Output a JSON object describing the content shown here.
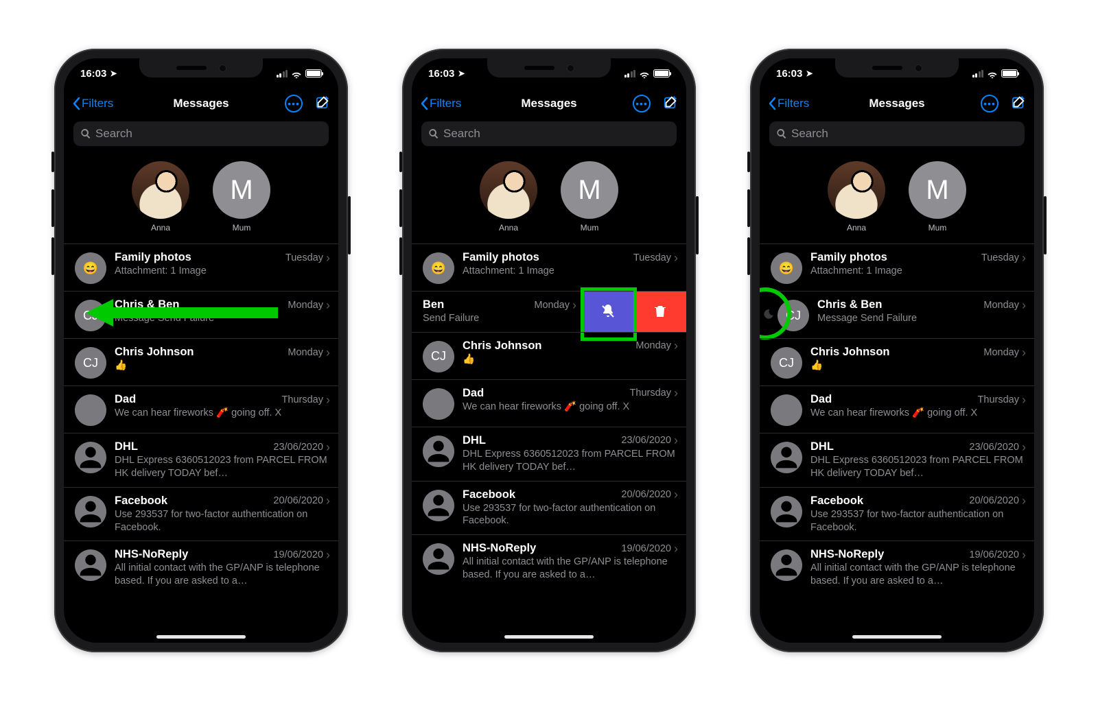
{
  "status": {
    "time": "16:03"
  },
  "nav": {
    "back": "Filters",
    "title": "Messages"
  },
  "search": {
    "placeholder": "Search"
  },
  "pinned": [
    {
      "name": "Anna",
      "avatar": "photo"
    },
    {
      "name": "Mum",
      "avatar": "M"
    }
  ],
  "conversations": [
    {
      "name": "Family photos",
      "preview": "Attachment: 1 Image",
      "date": "Tuesday",
      "avatar": "emoji"
    },
    {
      "name": "Chris & Ben",
      "preview": "Message Send Failure",
      "date": "Monday",
      "avatar": "chris"
    },
    {
      "name": "Chris Johnson",
      "preview": "👍",
      "date": "Monday",
      "avatar": "CJ"
    },
    {
      "name": "Dad",
      "preview": "We can hear fireworks 🧨 going off. X",
      "date": "Thursday",
      "avatar": "dad"
    },
    {
      "name": "DHL",
      "preview": "DHL Express 6360512023 from PARCEL FROM HK delivery TODAY bef…",
      "date": "23/06/2020",
      "avatar": "sil"
    },
    {
      "name": "Facebook",
      "preview": "Use 293537 for two-factor authentication on Facebook.",
      "date": "20/06/2020",
      "avatar": "sil"
    },
    {
      "name": "NHS-NoReply",
      "preview": "All initial contact with the GP/ANP is telephone based. If you are asked to a…",
      "date": "19/06/2020",
      "avatar": "sil"
    }
  ],
  "swipe_conv": {
    "name_partial": "Ben",
    "preview_partial": "Send Failure",
    "date": "Monday"
  },
  "swipe_actions": {
    "mute": "Hide Alerts",
    "delete": "Delete"
  },
  "annotations": {
    "arrow_hint": "swipe-left",
    "box_hint": "mute-action",
    "circle_hint": "do-not-disturb-icon"
  }
}
